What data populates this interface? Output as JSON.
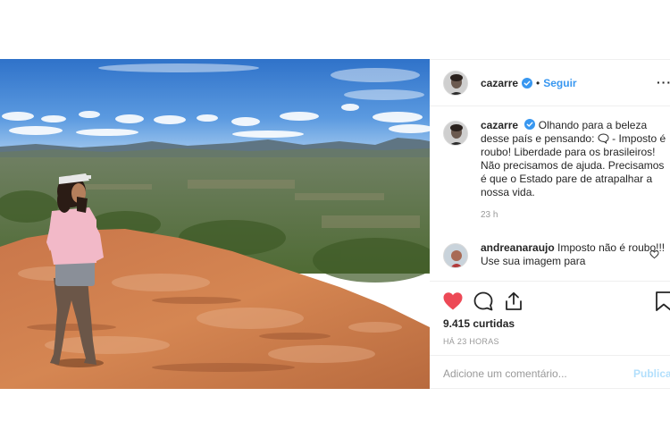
{
  "post": {
    "username": "cazarre",
    "follow_label": "Seguir",
    "separator": "•",
    "more_label": "···"
  },
  "comments": [
    {
      "username": "cazarre",
      "text_before_icon": "Olhando para a beleza desse país e pensando:",
      "text_after_icon": "- Imposto é roubo! Liberdade para os brasileiros! Não precisamos de ajuda. Precisamos é que o Estado pare de atrapalhar a nossa vida.",
      "time": "23 h"
    },
    {
      "username": "andreanaraujo",
      "text": "Imposto não é roubo!!! Use sua imagem para"
    }
  ],
  "likes": "9.415 curtidas",
  "timestamp": "HÁ 23 HORAS",
  "add_comment": {
    "placeholder": "Adicione um comentário...",
    "publish_label": "Publicar"
  },
  "colors": {
    "like_red": "#ed4956",
    "link_blue": "#3897f0",
    "verified_blue": "#3897f0",
    "muted": "#999999"
  },
  "icons": [
    "verified-badge-icon",
    "heart-icon",
    "comment-icon",
    "share-icon",
    "bookmark-icon",
    "heart-outline-icon",
    "speech-bubble-emoji-icon"
  ]
}
